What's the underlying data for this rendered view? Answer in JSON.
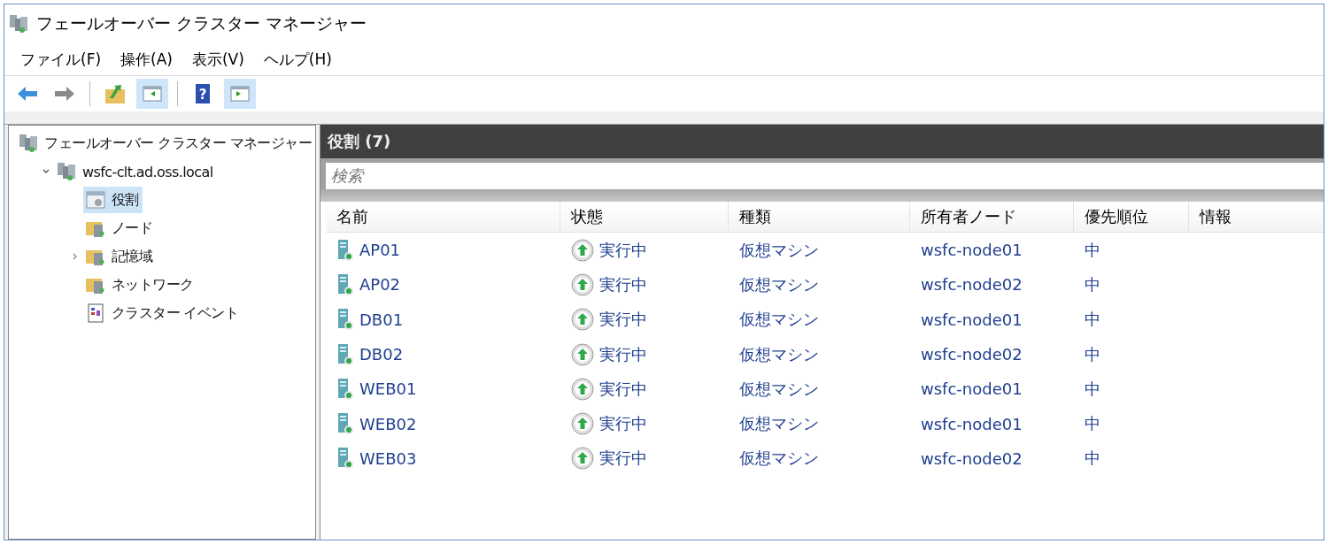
{
  "window": {
    "title": "フェールオーバー クラスター マネージャー"
  },
  "menu": [
    "ファイル(F)",
    "操作(A)",
    "表示(V)",
    "ヘルプ(H)"
  ],
  "toolbar": [
    {
      "kind": "back",
      "pressed": false
    },
    {
      "kind": "forward",
      "pressed": false
    },
    {
      "kind": "up",
      "pressed": false
    },
    {
      "kind": "console-tree",
      "pressed": true
    },
    {
      "kind": "help",
      "pressed": false,
      "glyph": "?"
    },
    {
      "kind": "action-pane",
      "pressed": true
    }
  ],
  "tree": [
    {
      "label": "フェールオーバー クラスター マネージャー",
      "kind": "manager",
      "selected": false,
      "children": [
        {
          "label": "wsfc-clt.ad.oss.local",
          "kind": "cluster",
          "selected": false,
          "expanded": true,
          "children": [
            {
              "label": "役割",
              "kind": "roles",
              "selected": true
            },
            {
              "label": "ノード",
              "kind": "nodes",
              "selected": false
            },
            {
              "label": "記憶域",
              "kind": "storage",
              "selected": false,
              "expanded": false
            },
            {
              "label": "ネットワーク",
              "kind": "network",
              "selected": false
            },
            {
              "label": "クラスター イベント",
              "kind": "events",
              "selected": false
            }
          ]
        }
      ]
    }
  ],
  "panel": {
    "title": "役割 (7)",
    "search": {
      "placeholder": "検索"
    },
    "columns": [
      "名前",
      "状態",
      "種類",
      "所有者ノード",
      "優先順位",
      "情報"
    ],
    "rows": [
      {
        "name": "AP01",
        "status": "実行中",
        "type": "仮想マシン",
        "owner": "wsfc-node01",
        "priority": "中"
      },
      {
        "name": "AP02",
        "status": "実行中",
        "type": "仮想マシン",
        "owner": "wsfc-node02",
        "priority": "中"
      },
      {
        "name": "DB01",
        "status": "実行中",
        "type": "仮想マシン",
        "owner": "wsfc-node01",
        "priority": "中"
      },
      {
        "name": "DB02",
        "status": "実行中",
        "type": "仮想マシン",
        "owner": "wsfc-node02",
        "priority": "中"
      },
      {
        "name": "WEB01",
        "status": "実行中",
        "type": "仮想マシン",
        "owner": "wsfc-node01",
        "priority": "中"
      },
      {
        "name": "WEB02",
        "status": "実行中",
        "type": "仮想マシン",
        "owner": "wsfc-node01",
        "priority": "中"
      },
      {
        "name": "WEB03",
        "status": "実行中",
        "type": "仮想マシン",
        "owner": "wsfc-node02",
        "priority": "中"
      }
    ]
  }
}
